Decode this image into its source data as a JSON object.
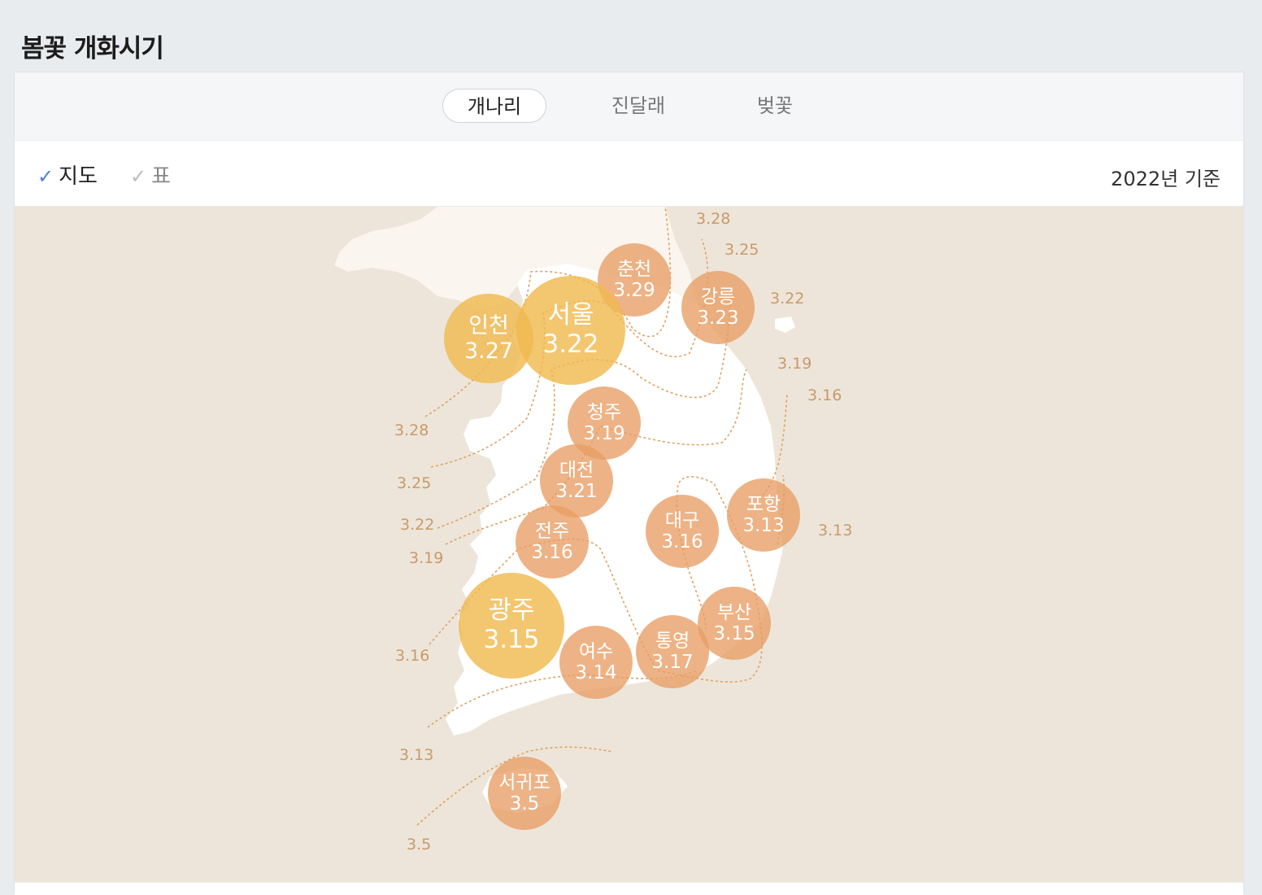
{
  "title": "봄꽃 개화시기",
  "tabs": [
    {
      "label": "개나리",
      "active": true
    },
    {
      "label": "진달래",
      "active": false
    },
    {
      "label": "벚꽃",
      "active": false
    }
  ],
  "view_toggles": [
    {
      "label": "지도",
      "checked": true
    },
    {
      "label": "표",
      "checked": false
    }
  ],
  "basis": "2022년 기준",
  "cities": [
    {
      "name": "춘천",
      "value": "3.29"
    },
    {
      "name": "강릉",
      "value": "3.23"
    },
    {
      "name": "인천",
      "value": "3.27"
    },
    {
      "name": "서울",
      "value": "3.22"
    },
    {
      "name": "청주",
      "value": "3.19"
    },
    {
      "name": "대전",
      "value": "3.21"
    },
    {
      "name": "대구",
      "value": "3.16"
    },
    {
      "name": "포항",
      "value": "3.13"
    },
    {
      "name": "전주",
      "value": "3.16"
    },
    {
      "name": "광주",
      "value": "3.15"
    },
    {
      "name": "부산",
      "value": "3.15"
    },
    {
      "name": "통영",
      "value": "3.17"
    },
    {
      "name": "여수",
      "value": "3.14"
    },
    {
      "name": "서귀포",
      "value": "3.5"
    }
  ],
  "contour_labels": [
    "3.28",
    "3.25",
    "3.22",
    "3.19",
    "3.16",
    "3.13",
    "3.28",
    "3.25",
    "3.22",
    "3.19",
    "3.16",
    "3.13",
    "3.5"
  ],
  "colors": {
    "city_small": "#e89e64",
    "city_large": "#f0ba50",
    "contour": "#e0a262",
    "land": "#ffffff",
    "sea": "#ede5d9",
    "check_on": "#4a7fdc"
  }
}
